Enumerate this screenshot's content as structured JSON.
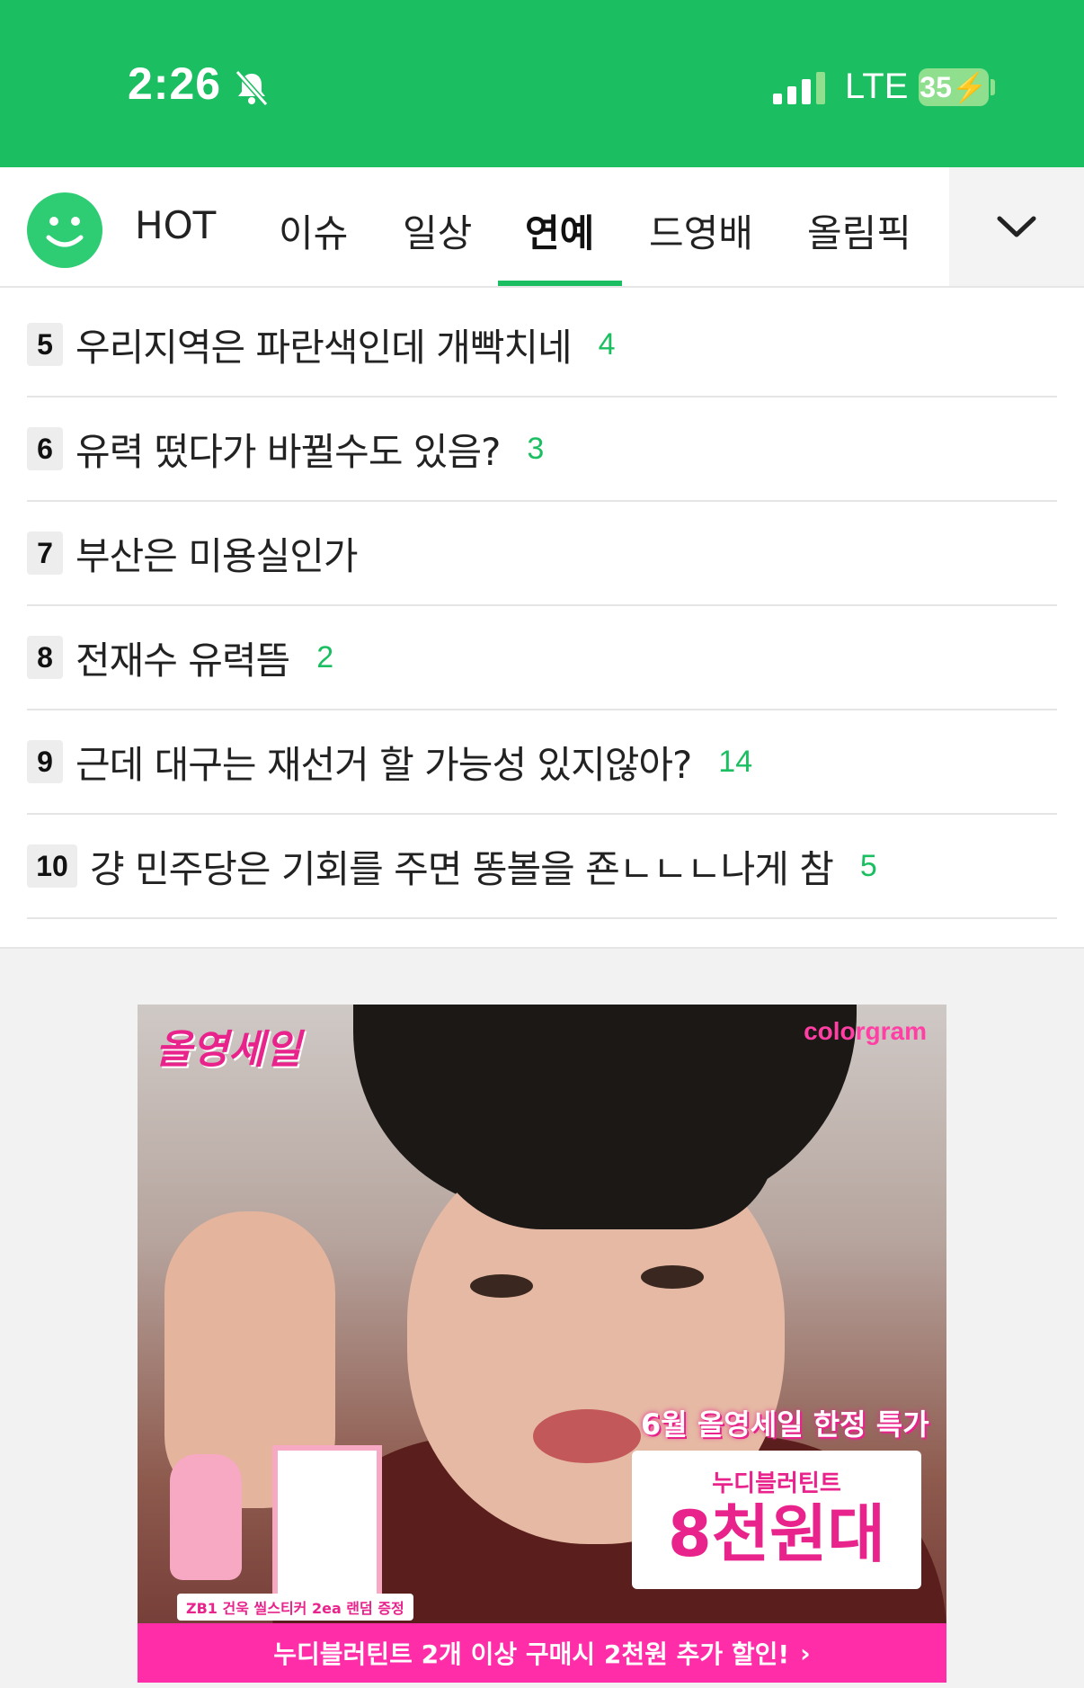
{
  "status_bar": {
    "time": "2:26",
    "network": "LTE",
    "battery": "35"
  },
  "tabs": [
    {
      "label": "HOT",
      "active": false
    },
    {
      "label": "이슈",
      "active": false
    },
    {
      "label": "일상",
      "active": false
    },
    {
      "label": "연예",
      "active": true
    },
    {
      "label": "드영배",
      "active": false
    },
    {
      "label": "올림픽",
      "active": false
    }
  ],
  "list": [
    {
      "rank": "5",
      "title": "우리지역은 파란색인데 개빡치네",
      "comments": "4"
    },
    {
      "rank": "6",
      "title": "유력 떴다가 바뀔수도 있음?",
      "comments": "3"
    },
    {
      "rank": "7",
      "title": "부산은 미용실인가",
      "comments": ""
    },
    {
      "rank": "8",
      "title": "전재수 유력뜸",
      "comments": "2"
    },
    {
      "rank": "9",
      "title": "근데 대구는 재선거 할 가능성 있지않아?",
      "comments": "14"
    },
    {
      "rank": "10",
      "title": "걍 민주당은 기회를 주면 똥볼을 죤ㄴㄴㄴ나게 참",
      "comments": "5"
    }
  ],
  "ad": {
    "logo_text": "올영세일",
    "brand": "colorgram",
    "promo": "6월 올영세일 한정 특가",
    "price_sub": "누디블러틴트",
    "price_main": "8천원대",
    "gift_label": "ZB1 건욱 씰스티커 2ea 랜덤 증정",
    "bottom_text": "누디블러틴트 2개 이상 구매시 2천원 추가 할인!"
  },
  "colors": {
    "brand_green": "#1bbf61",
    "ad_pink": "#ff2ea8"
  }
}
